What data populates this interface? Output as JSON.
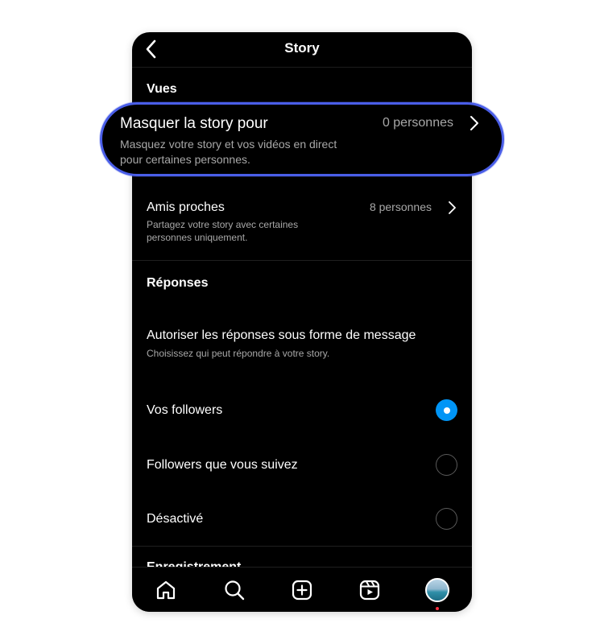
{
  "header": {
    "title": "Story"
  },
  "sections": {
    "views": "Vues",
    "replies": "Réponses",
    "partial_next": "Enregistrement"
  },
  "hide_story": {
    "label": "Masquer la story pour",
    "description": "Masquez votre story et vos vidéos en direct pour certaines personnes.",
    "value": "0 personnes"
  },
  "close_friends": {
    "label": "Amis proches",
    "description": "Partagez votre story avec certaines personnes uniquement.",
    "value": "8 personnes"
  },
  "message_replies": {
    "label": "Autoriser les réponses sous forme de message",
    "description": "Choisissez qui peut répondre à votre story."
  },
  "reply_options": [
    {
      "label": "Vos followers",
      "selected": true
    },
    {
      "label": "Followers que vous suivez",
      "selected": false
    },
    {
      "label": "Désactivé",
      "selected": false
    }
  ],
  "bottom_nav": [
    "home-icon",
    "search-icon",
    "create-icon",
    "reels-icon",
    "profile-avatar"
  ],
  "colors": {
    "accent": "#0095f6",
    "highlight_border": "#4a5ee8",
    "background": "#000000",
    "notification": "#ff3040"
  }
}
